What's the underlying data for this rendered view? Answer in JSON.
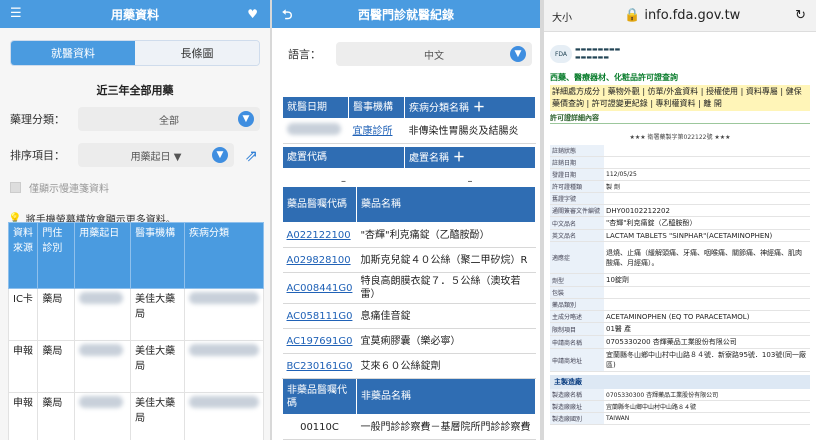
{
  "panel1": {
    "header_title": "用藥資料",
    "tabs": [
      "就醫資料",
      "長條圖"
    ],
    "section_title": "近三年全部用藥",
    "category_label": "藥理分類：",
    "category_value": "全部",
    "sort_label": "排序項目：",
    "sort_value": "用藥起日 ▼",
    "checkbox_label": "僅顯示慢連箋資料",
    "hint": "將手機螢幕橫放會顯示更多資料。",
    "columns": [
      "資料來源",
      "門住診別",
      "用藥起日",
      "醫事機構",
      "疾病分類"
    ],
    "rows": [
      {
        "source": "IC卡",
        "type": "藥局",
        "org": "美佳大藥局"
      },
      {
        "source": "申報",
        "type": "藥局",
        "org": "美佳大藥局"
      },
      {
        "source": "申報",
        "type": "藥局",
        "org": "美佳大藥局"
      }
    ]
  },
  "panel2": {
    "header_title": "西醫門診就醫紀錄",
    "lang_label": "語言：",
    "lang_value": "中文",
    "h_visit_date": "就醫日期",
    "h_org": "醫事機構",
    "h_disease": "疾病分類名稱",
    "org": "宜康診所",
    "disease": "非傳染性胃腸炎及結腸炎",
    "h_proc_code": "處置代碼",
    "h_proc_name": "處置名稱",
    "dash": "–",
    "h_drug_code": "藥品醫囑代碼",
    "h_drug_name": "藥品名稱",
    "drugs": [
      {
        "code": "A022122100",
        "name": "\"杏輝\"利克痛錠（乙醯胺酚）"
      },
      {
        "code": "A029828100",
        "name": "加斯克兒錠４０公絲（聚二甲矽烷）R"
      },
      {
        "code": "AC008441G0",
        "name": "特良高朗膜衣錠７．５公絲（澳玫若雷）"
      },
      {
        "code": "AC058111G0",
        "name": "息痛佳音錠"
      },
      {
        "code": "AC197691G0",
        "name": "宜莫痢膠囊（樂必寧）"
      },
      {
        "code": "BC230161G0",
        "name": "艾來６０公絲錠劑"
      }
    ],
    "h_nondrug_code": "非藥品醫囑代碼",
    "h_nondrug_name": "非藥品名稱",
    "nondrug": {
      "code": "00110C",
      "name": "一般門診診察費－基層院所門診診察費"
    }
  },
  "panel3": {
    "text_size": "大小",
    "url": "info.fda.gov.tw",
    "nav1": "西藥、醫療器材、化粧品許可證查詢",
    "nav2": "詳細處方成分 | 藥物外觀 | 仿單/外盒資料 | 授權使用 | 資料專屬 | 健保藥價查詢 | 許可證變更紀錄 | 專利權資料 | 離 開",
    "nav3": "許可證詳細內容",
    "license_no": "★★★ 衛署藥製字第022122號 ★★★",
    "fields": [
      {
        "k": "註銷狀態",
        "v": ""
      },
      {
        "k": "註銷日期",
        "v": ""
      },
      {
        "k": "發證日期",
        "v": "112/05/25"
      },
      {
        "k": "許可證種類",
        "v": "製 劑"
      },
      {
        "k": "舊證字號",
        "v": ""
      },
      {
        "k": "通關簽審文件編號",
        "v": "DHY00102212202"
      },
      {
        "k": "中文品名",
        "v": "\"杏輝\"利克痛錠（乙醯胺酚）"
      },
      {
        "k": "英文品名",
        "v": "LACTAM TABLETS \"SINPHAR\"(ACETAMINOPHEN)"
      },
      {
        "k": "適應症",
        "v": "退燒、止痛（緩解頭痛、牙痛、咽喉痛、關節痛、神經痛、肌肉酸痛、月經痛）。"
      },
      {
        "k": "劑型",
        "v": "10錠劑"
      },
      {
        "k": "包裝",
        "v": ""
      },
      {
        "k": "藥品類別",
        "v": ""
      },
      {
        "k": "主成分略述",
        "v": "ACETAMINOPHEN (EQ TO PARACETAMOL)"
      },
      {
        "k": "限制項目",
        "v": "01醫 產"
      },
      {
        "k": "申請商名稱",
        "v": "0705330200 杏輝藥品工業股份有限公司"
      },
      {
        "k": "申請商地址",
        "v": "宜蘭縣冬山鄉中山村中山路８４號．新寮路95號．103號(同一廠區)"
      }
    ],
    "maker_title": "主製造廠",
    "maker": [
      {
        "k": "製造廠名稱",
        "v": "0705330300 杏輝藥品工業股份有限公司"
      },
      {
        "k": "製造廠廠址",
        "v": "宜蘭縣冬山鄉中山村中山路８４號"
      },
      {
        "k": "製造廠國別",
        "v": "TAIWAN"
      }
    ]
  }
}
